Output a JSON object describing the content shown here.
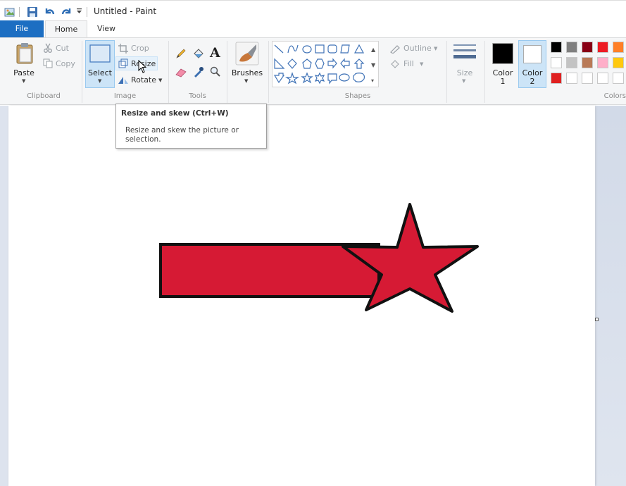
{
  "window": {
    "title": "Untitled - Paint"
  },
  "tabs": {
    "file": "File",
    "home": "Home",
    "view": "View"
  },
  "clipboard": {
    "paste": "Paste",
    "cut": "Cut",
    "copy": "Copy",
    "group_label": "Clipboard"
  },
  "image": {
    "select": "Select",
    "crop": "Crop",
    "resize": "Resize",
    "rotate": "Rotate",
    "group_label": "Image"
  },
  "tools": {
    "text_tool_glyph": "A",
    "group_label": "Tools"
  },
  "brushes": {
    "label": "Brushes"
  },
  "shapes": {
    "outline": "Outline",
    "fill": "Fill",
    "group_label": "Shapes"
  },
  "size": {
    "label": "Size"
  },
  "colors": {
    "color1_label_line1": "Color",
    "color1_label_line2": "1",
    "color2_label_line1": "Color",
    "color2_label_line2": "2",
    "group_label": "Colors",
    "color1_value": "#000000",
    "color2_value": "#ffffff",
    "palette_row1": [
      "#000000",
      "#7f7f7f",
      "#880015",
      "#ed1c24",
      "#ff7f27"
    ],
    "palette_row2": [
      "#ffffff",
      "#c3c3c3",
      "#b97a57",
      "#ffaec9",
      "#ffc90e"
    ],
    "palette_row3": [
      "#e02020",
      "#ffffff",
      "#ffffff",
      "#ffffff",
      "#ffffff"
    ]
  },
  "tooltip": {
    "title": "Resize and skew (Ctrl+W)",
    "description": "Resize and skew the picture or selection."
  },
  "drawing": {
    "fill_color": "#d61a34",
    "outline_color": "#111111"
  },
  "icons": [
    "paint-app-icon",
    "save-icon",
    "undo-icon",
    "redo-icon",
    "customize-icon",
    "paste-icon",
    "cut-icon",
    "copy-icon",
    "select-icon",
    "crop-icon",
    "resize-icon",
    "rotate-icon",
    "pencil-icon",
    "fill-icon",
    "text-icon",
    "eraser-icon",
    "color-picker-icon",
    "magnifier-icon",
    "brushes-icon",
    "outline-icon",
    "fill-shape-icon",
    "size-icon",
    "mouse-cursor-icon"
  ]
}
